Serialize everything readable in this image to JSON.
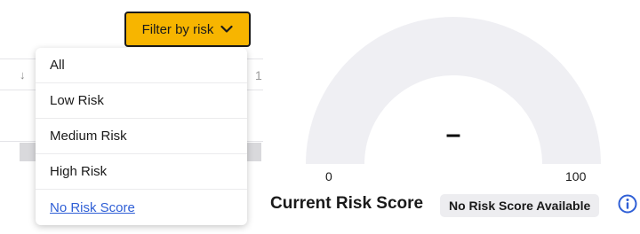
{
  "filter": {
    "button_label": "Filter by risk",
    "icon": "chevron-down-icon",
    "accent_color": "#f7b500"
  },
  "dropdown": {
    "items": [
      {
        "label": "All"
      },
      {
        "label": "Low Risk"
      },
      {
        "label": "Medium Risk"
      },
      {
        "label": "High Risk"
      },
      {
        "label": "No Risk Score"
      }
    ],
    "selected": "No Risk Score",
    "selected_color": "#2f5fd6"
  },
  "table_fragment": {
    "sort_icon": "arrow-down-icon",
    "partial_value": "1"
  },
  "gauge": {
    "value_display": "–",
    "min_label": "0",
    "max_label": "100",
    "track_color": "#efeff3"
  },
  "score": {
    "title": "Current Risk Score",
    "badge": "No Risk Score Available",
    "info_icon": "info-icon",
    "info_color": "#2f5fd6"
  }
}
